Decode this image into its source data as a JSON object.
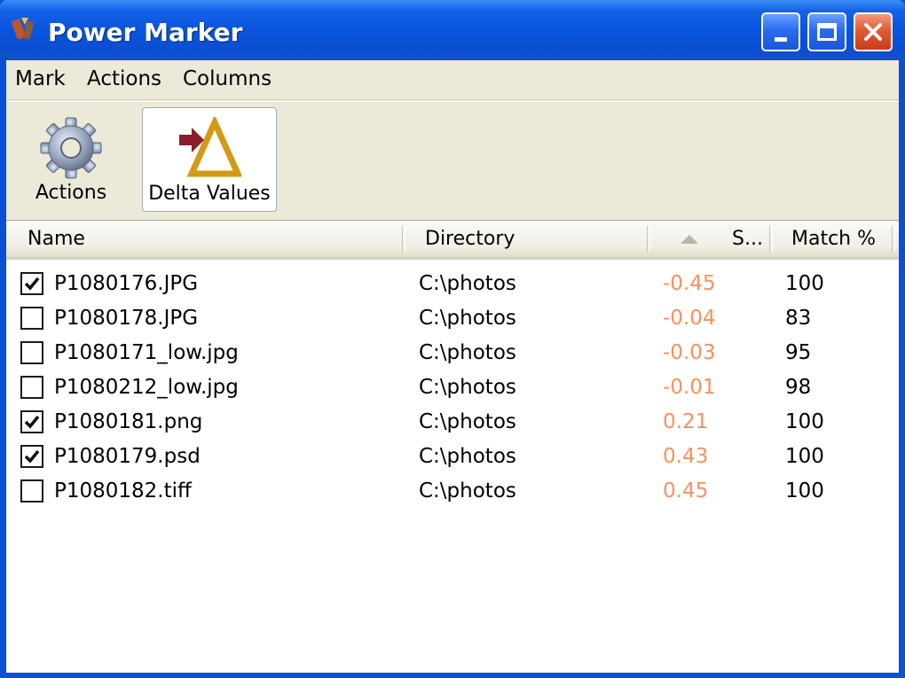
{
  "window": {
    "title": "Power Marker",
    "controls": {
      "minimize": "minimize",
      "maximize": "maximize",
      "close": "close"
    }
  },
  "menu": [
    "Mark",
    "Actions",
    "Columns"
  ],
  "toolbar": {
    "actions_label": "Actions",
    "delta_label": "Delta Values"
  },
  "columns": {
    "name": "Name",
    "directory": "Directory",
    "s": "S...",
    "match": "Match %"
  },
  "rows": [
    {
      "checked": true,
      "name": "P1080176.JPG",
      "directory": "C:\\photos",
      "delta": "-0.45",
      "match": "100"
    },
    {
      "checked": false,
      "name": "P1080178.JPG",
      "directory": "C:\\photos",
      "delta": "-0.04",
      "match": "83"
    },
    {
      "checked": false,
      "name": "P1080171_low.jpg",
      "directory": "C:\\photos",
      "delta": "-0.03",
      "match": "95"
    },
    {
      "checked": false,
      "name": "P1080212_low.jpg",
      "directory": "C:\\photos",
      "delta": "-0.01",
      "match": "98"
    },
    {
      "checked": true,
      "name": "P1080181.png",
      "directory": "C:\\photos",
      "delta": "0.21",
      "match": "100"
    },
    {
      "checked": true,
      "name": "P1080179.psd",
      "directory": "C:\\photos",
      "delta": "0.43",
      "match": "100"
    },
    {
      "checked": false,
      "name": "P1080182.tiff",
      "directory": "C:\\photos",
      "delta": "0.45",
      "match": "100"
    }
  ],
  "colors": {
    "titlebar": "#0a54de",
    "face": "#ece9d8",
    "delta_value": "#f7925e",
    "close_button": "#e05a35"
  },
  "icons": {
    "app": "power-marker-icon",
    "actions": "gear-icon",
    "delta": "delta-arrow-icon",
    "sort": "sort-ascending-icon"
  }
}
